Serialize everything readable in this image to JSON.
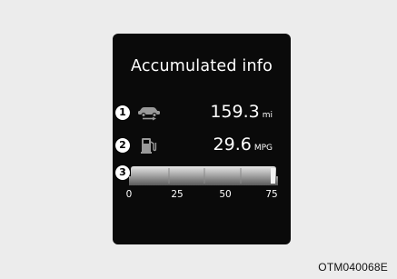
{
  "screen": {
    "title": "Accumulated info"
  },
  "rows": [
    {
      "callout": "1",
      "icon": "car-distance-icon",
      "value": "159.3",
      "unit": "mi"
    },
    {
      "callout": "2",
      "icon": "fuel-pump-icon",
      "value": "29.6",
      "unit": "MPG"
    }
  ],
  "fuel_bar": {
    "callout": "3",
    "scale_labels": [
      "0",
      "25",
      "50",
      "75"
    ]
  },
  "figure_code": "OTM040068E"
}
